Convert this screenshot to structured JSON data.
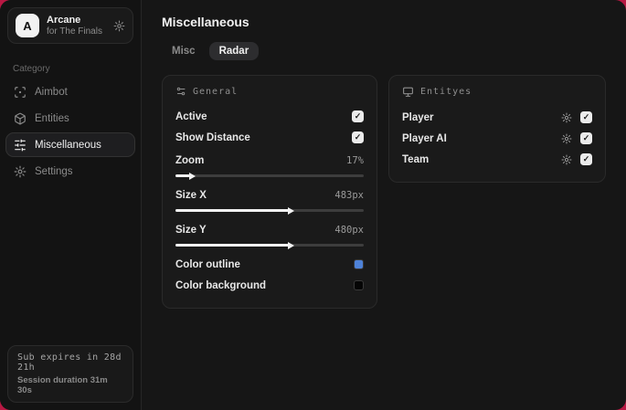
{
  "app": {
    "name": "Arcane",
    "subtitle": "for The Finals",
    "logo_letter": "A"
  },
  "icons": {
    "check": "✓"
  },
  "sidebar": {
    "category_label": "Category",
    "items": [
      {
        "label": "Aimbot",
        "active": false
      },
      {
        "label": "Entities",
        "active": false
      },
      {
        "label": "Miscellaneous",
        "active": true
      },
      {
        "label": "Settings",
        "active": false
      }
    ],
    "subscription": {
      "line1": "Sub expires in 28d 21h",
      "line2": "Session duration 31m 30s"
    }
  },
  "main": {
    "title": "Miscellaneous",
    "tabs": [
      {
        "label": "Misc",
        "active": false
      },
      {
        "label": "Radar",
        "active": true
      }
    ],
    "general_panel": {
      "title": "General",
      "toggles": [
        {
          "label": "Active",
          "checked": true
        },
        {
          "label": "Show Distance",
          "checked": true
        }
      ],
      "sliders": [
        {
          "label": "Zoom",
          "value": "17%",
          "percent": 8
        },
        {
          "label": "Size X",
          "value": "483px",
          "percent": 60
        },
        {
          "label": "Size Y",
          "value": "480px",
          "percent": 60
        }
      ],
      "colors": [
        {
          "label": "Color outline",
          "swatch": "#4e82d8"
        },
        {
          "label": "Color background",
          "swatch": "#050505"
        }
      ]
    },
    "entities_panel": {
      "title": "Entityes",
      "rows": [
        {
          "label": "Player",
          "checked": true
        },
        {
          "label": "Player AI",
          "checked": true
        },
        {
          "label": "Team",
          "checked": true
        }
      ]
    }
  },
  "colors": {
    "backdrop": "#b81843",
    "accent_swatch": "#4e82d8"
  }
}
